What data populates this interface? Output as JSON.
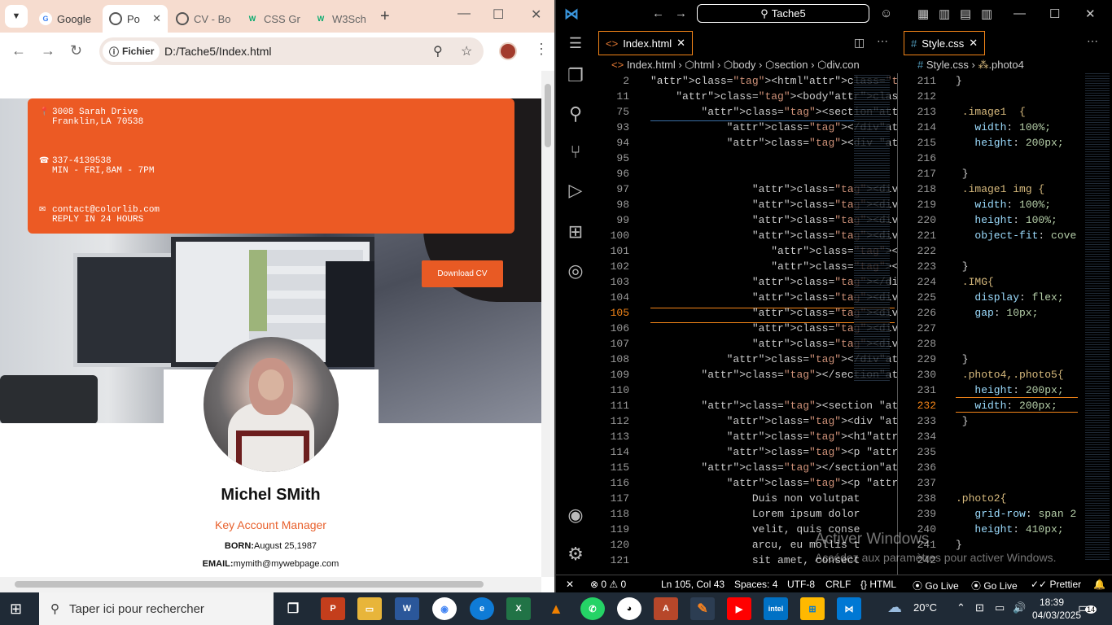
{
  "chrome": {
    "tabs": [
      {
        "title": "Google",
        "favicon": "G",
        "color": "#4285f4",
        "active": false
      },
      {
        "title": "Po",
        "favicon": "globe-icon",
        "color": "#555",
        "active": true
      },
      {
        "title": "CV - Bo",
        "favicon": "globe-icon",
        "color": "#555",
        "active": false
      },
      {
        "title": "CSS Gr",
        "favicon": "W",
        "color": "#04aa6d",
        "active": false
      },
      {
        "title": "W3Sch",
        "favicon": "W",
        "color": "#04aa6d",
        "active": false
      }
    ],
    "site_chip": "Fichier",
    "url": "D:/Tache5/Index.html"
  },
  "page": {
    "address_line1": "3008 Sarah Drive",
    "address_line2": "Franklin,LA 70538",
    "phone_line1": "337-4139538",
    "phone_line2": "MIN - FRI,8AM - 7PM",
    "email_line1": "contact@colorlib.com",
    "email_line2": "REPLY IN 24 HOURS",
    "download_cv": "Download CV",
    "name": "Michel SMith",
    "title": "Key Account Manager",
    "born_label": "BORN:",
    "born_value": "August 25,1987",
    "email_label": "EMAIL:",
    "email_value": "mymith@mywebpage.com"
  },
  "vscode": {
    "command_center": "Tache5",
    "tab_left": "Index.html",
    "tab_right": "Style.css",
    "breadcrumb_left": [
      "Index.html",
      "html",
      "body",
      "section",
      "div.con"
    ],
    "breadcrumb_right": [
      "Style.css",
      ".photo4"
    ],
    "html_lines": [
      {
        "n": "2",
        "code": "<html>"
      },
      {
        "n": "11",
        "code": "    <body>"
      },
      {
        "n": "75",
        "code": "        <section>"
      },
      {
        "n": "93",
        "code": "            </div>"
      },
      {
        "n": "94",
        "code": "            <div class=\"container"
      },
      {
        "n": "95",
        "code": ""
      },
      {
        "n": "96",
        "code": ""
      },
      {
        "n": "97",
        "code": "                <div class=\"image"
      },
      {
        "n": "98",
        "code": "                <div class=\"image"
      },
      {
        "n": "99",
        "code": "                <div class=\"image"
      },
      {
        "n": "100",
        "code": "                <div class=\"IMG\">"
      },
      {
        "n": "101",
        "code": "                   <div class=\"im"
      },
      {
        "n": "102",
        "code": "                   <div class=\"im"
      },
      {
        "n": "103",
        "code": "                </div>"
      },
      {
        "n": "104",
        "code": "                <div class=\"image"
      },
      {
        "n": "105",
        "code": "                <div class=\"image"
      },
      {
        "n": "106",
        "code": "                <div class=\"image"
      },
      {
        "n": "107",
        "code": "                <div class=\"image"
      },
      {
        "n": "108",
        "code": "            </div>"
      },
      {
        "n": "109",
        "code": "        </section>"
      },
      {
        "n": "110",
        "code": ""
      },
      {
        "n": "111",
        "code": "        <section class=\"porto\">"
      },
      {
        "n": "112",
        "code": "            <div class=\"butt\"></d"
      },
      {
        "n": "113",
        "code": "            <h1>About me</h1>"
      },
      {
        "n": "114",
        "code": "            <p class=\"m\"> PROFESS"
      },
      {
        "n": "115",
        "code": "        </section>"
      },
      {
        "n": "116",
        "code": "            <p class=\"p5\">"
      },
      {
        "n": "117",
        "code": "                Duis non volutpat"
      },
      {
        "n": "118",
        "code": "                Lorem ipsum dolor"
      },
      {
        "n": "119",
        "code": "                velit, quis conse"
      },
      {
        "n": "120",
        "code": "                arcu, eu mollis t"
      },
      {
        "n": "121",
        "code": "                sit amet, consect"
      }
    ],
    "css_lines": [
      {
        "n": "211",
        "code": "}"
      },
      {
        "n": "212",
        "code": ""
      },
      {
        "n": "213",
        "code": " .image1  {"
      },
      {
        "n": "214",
        "code": "   width: 100%;"
      },
      {
        "n": "215",
        "code": "   height: 200px;"
      },
      {
        "n": "216",
        "code": ""
      },
      {
        "n": "217",
        "code": " }"
      },
      {
        "n": "218",
        "code": " .image1 img {"
      },
      {
        "n": "219",
        "code": "   width: 100%;"
      },
      {
        "n": "220",
        "code": "   height: 100%;"
      },
      {
        "n": "221",
        "code": "   object-fit: cove"
      },
      {
        "n": "222",
        "code": ""
      },
      {
        "n": "223",
        "code": " }"
      },
      {
        "n": "224",
        "code": " .IMG{"
      },
      {
        "n": "225",
        "code": "   display: flex;"
      },
      {
        "n": "226",
        "code": "   gap: 10px;"
      },
      {
        "n": "227",
        "code": ""
      },
      {
        "n": "228",
        "code": ""
      },
      {
        "n": "229",
        "code": " }"
      },
      {
        "n": "230",
        "code": " .photo4,.photo5{"
      },
      {
        "n": "231",
        "code": "   height: 200px;"
      },
      {
        "n": "232",
        "code": "   width: 200px;"
      },
      {
        "n": "233",
        "code": " }"
      },
      {
        "n": "234",
        "code": ""
      },
      {
        "n": "235",
        "code": ""
      },
      {
        "n": "236",
        "code": ""
      },
      {
        "n": "237",
        "code": ""
      },
      {
        "n": "238",
        "code": ".photo2{"
      },
      {
        "n": "239",
        "code": "   grid-row: span 2"
      },
      {
        "n": "240",
        "code": "   height: 410px;"
      },
      {
        "n": "241",
        "code": "}"
      },
      {
        "n": "242",
        "code": ""
      }
    ],
    "activate_title": "Activer Windows",
    "activate_sub": "Accédez aux paramètres pour activer Windows.",
    "status": {
      "errors": "0",
      "warnings": "0",
      "position": "Ln 105, Col 43",
      "spaces": "Spaces: 4",
      "encoding": "UTF-8",
      "eol": "CRLF",
      "language": "HTML",
      "golive1": "Go Live",
      "golive2": "Go Live",
      "prettier": "Prettier"
    }
  },
  "taskbar": {
    "search_placeholder": "Taper ici pour rechercher",
    "temperature": "20°C",
    "time": "18:39",
    "date": "04/03/2025",
    "notifications": "14"
  }
}
